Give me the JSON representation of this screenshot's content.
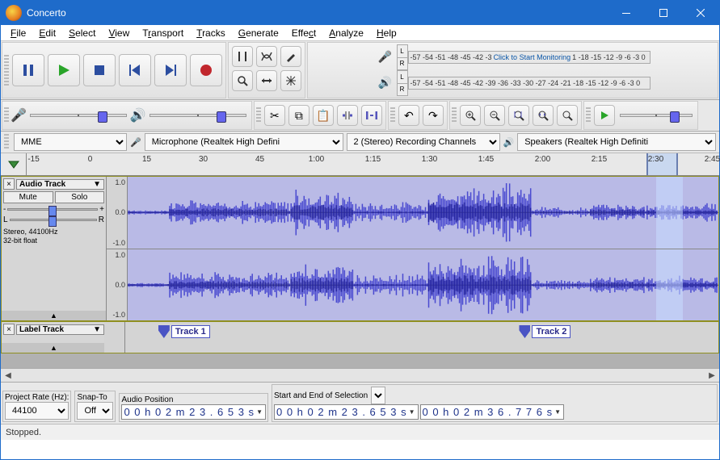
{
  "title": "Concerto",
  "menu": [
    "File",
    "Edit",
    "Select",
    "View",
    "Transport",
    "Tracks",
    "Generate",
    "Effect",
    "Analyze",
    "Help"
  ],
  "meter": {
    "ticks_rec": "-57 -54 -51 -48 -45 -42 -3",
    "click_text": "Click to Start Monitoring",
    "ticks_rec2": "1 -18 -15 -12  -9  -6  -3   0",
    "ticks_play": "-57 -54 -51 -48 -45 -42 -39 -36 -33 -30 -27 -24 -21 -18 -15 -12  -9  -6  -3   0",
    "L": "L",
    "R": "R"
  },
  "devices": {
    "host": "MME",
    "input": "Microphone (Realtek High Defini",
    "channels": "2 (Stereo) Recording Channels",
    "output": "Speakers (Realtek High Definiti"
  },
  "ruler": {
    "ticks": [
      "-15",
      "0",
      "15",
      "30",
      "45",
      "1:00",
      "1:15",
      "1:30",
      "1:45",
      "2:00",
      "2:15",
      "2:30",
      "2:45"
    ],
    "cursor_pct": 7,
    "sel_start_pct": 89.5,
    "sel_end_pct": 94
  },
  "audio_track": {
    "name": "Audio Track",
    "mute": "Mute",
    "solo": "Solo",
    "gain_minus": "-",
    "gain_plus": "+",
    "pan_l": "L",
    "pan_r": "R",
    "info1": "Stereo, 44100Hz",
    "info2": "32-bit float",
    "scale": [
      "1.0",
      "0.0",
      "-1.0"
    ]
  },
  "label_track": {
    "name": "Label Track",
    "labels": [
      {
        "text": "Track 1",
        "pct": 5
      },
      {
        "text": "Track 2",
        "pct": 64
      }
    ]
  },
  "bottom": {
    "project_rate_lbl": "Project Rate (Hz):",
    "project_rate": "44100",
    "snap_lbl": "Snap-To",
    "snap": "Off",
    "audio_pos_lbl": "Audio Position",
    "audio_pos": "0 0 h 0 2 m 2 3 . 6 5 3 s",
    "sel_lbl": "Start and End of Selection",
    "sel_start": "0 0 h 0 2 m 2 3 . 6 5 3 s",
    "sel_end": "0 0 h 0 2 m 3 6 . 7 7 6 s"
  },
  "status": "Stopped."
}
